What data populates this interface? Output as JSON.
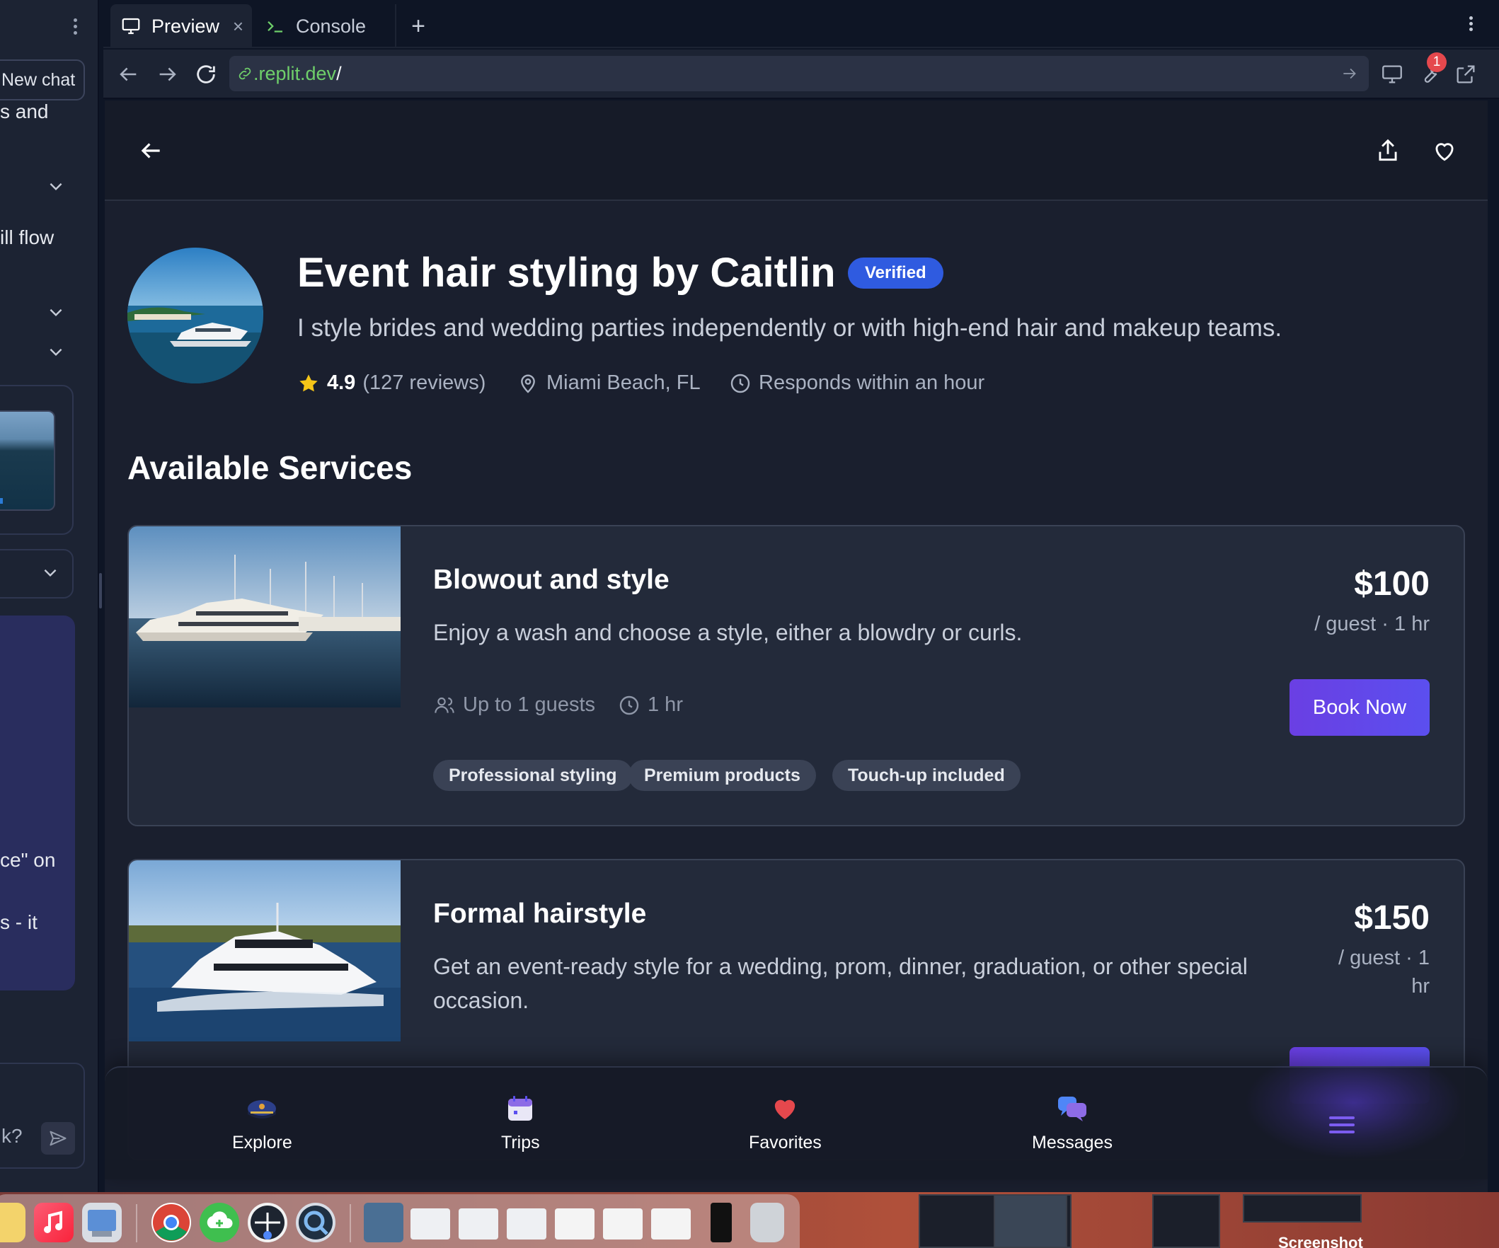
{
  "left_panel": {
    "new_chat_label": "New chat",
    "fragments": [
      "s and",
      "ill flow",
      "ce\" on",
      "s - it",
      "k?"
    ]
  },
  "tabs": {
    "preview_label": "Preview",
    "console_label": "Console"
  },
  "address_bar": {
    "url_host": ".replit.dev",
    "url_path": "/",
    "notification_count": "1"
  },
  "header": {},
  "profile": {
    "title": "Event hair styling by Caitlin",
    "verified_label": "Verified",
    "subtitle": "I style brides and wedding parties independently or with high-end hair and makeup teams.",
    "rating": "4.9",
    "reviews": "(127 reviews)",
    "location": "Miami Beach, FL",
    "response_time": "Responds within an hour"
  },
  "services_section": {
    "title": "Available Services",
    "services": [
      {
        "title": "Blowout and style",
        "description": "Enjoy a wash and choose a style, either a blowdry or curls.",
        "price": "$100",
        "unit": "/ guest · 1 hr",
        "guests": "Up to 1 guests",
        "duration": "1 hr",
        "book_label": "Book Now",
        "tags": [
          "Professional styling",
          "Premium products",
          "Touch-up included"
        ]
      },
      {
        "title": "Formal hairstyle",
        "description": "Get an event-ready style for a wedding, prom, dinner, graduation, or other special occasion.",
        "price": "$150",
        "unit": "/ guest · 1 hr"
      }
    ]
  },
  "bottom_nav": {
    "items": [
      {
        "label": "Explore",
        "icon": "captain-hat-icon"
      },
      {
        "label": "Trips",
        "icon": "calendar-icon"
      },
      {
        "label": "Favorites",
        "icon": "heart-icon"
      },
      {
        "label": "Messages",
        "icon": "chat-bubbles-icon"
      }
    ],
    "menu_icon": "menu-icon"
  },
  "colors": {
    "accent_purple": "#5b4fef",
    "verified_blue": "#2f5be0",
    "url_green": "#6fcf6a",
    "star_yellow": "#f5c518",
    "favorite_red": "#e5484d"
  },
  "desktop": {
    "screenshot_label": "Screenshot"
  }
}
